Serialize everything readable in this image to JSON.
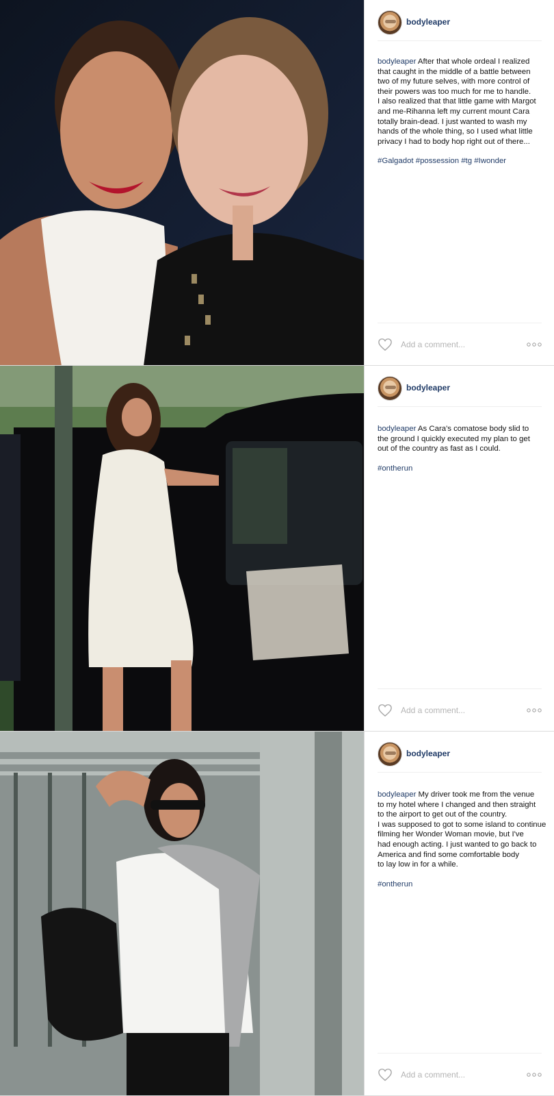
{
  "colors": {
    "username": "#1f3a66",
    "divider": "#dbdbdb",
    "placeholder": "#b4b4b4"
  },
  "posts": [
    {
      "photo_alt": "photo",
      "username": "bodyleaper",
      "caption_user": "bodyleaper",
      "caption": "After that whole ordeal I realized\nthat caught in the middle of a battle between\ntwo of my future selves, with more control of\ntheir powers was too much for me to handle.\nI also realized that that little game with Margot\nand me-Rihanna left my current mount Cara\ntotally brain-dead. I just wanted to wash my\nhands of the whole thing, so I used what little\nprivacy I had to body hop right out of there...",
      "hashtags": "#Galgadot #possession #tg #Iwonder",
      "comment_placeholder": "Add a comment...",
      "icons": {
        "like": "heart-outline-icon",
        "more": "more-options-icon"
      }
    },
    {
      "photo_alt": "photo",
      "username": "bodyleaper",
      "caption_user": "bodyleaper",
      "caption": "As Cara's comatose body slid to\nthe ground I quickly executed my plan to get\nout of the country as fast as  I could.",
      "hashtags": "#ontherun",
      "comment_placeholder": "Add a comment...",
      "icons": {
        "like": "heart-outline-icon",
        "more": "more-options-icon"
      }
    },
    {
      "photo_alt": "photo",
      "username": "bodyleaper",
      "caption_user": "bodyleaper",
      "caption": "My driver took me from the venue\nto my hotel where I changed and then straight\nto the airport to get out of the country.\nI was supposed to got to some island to continue\nfilming her Wonder Woman movie, but I've\nhad enough acting. I just wanted to go back to\nAmerica and find some comfortable body\nto lay low in for a while.",
      "hashtags": "#ontherun",
      "comment_placeholder": "Add a comment...",
      "icons": {
        "like": "heart-outline-icon",
        "more": "more-options-icon"
      }
    }
  ]
}
